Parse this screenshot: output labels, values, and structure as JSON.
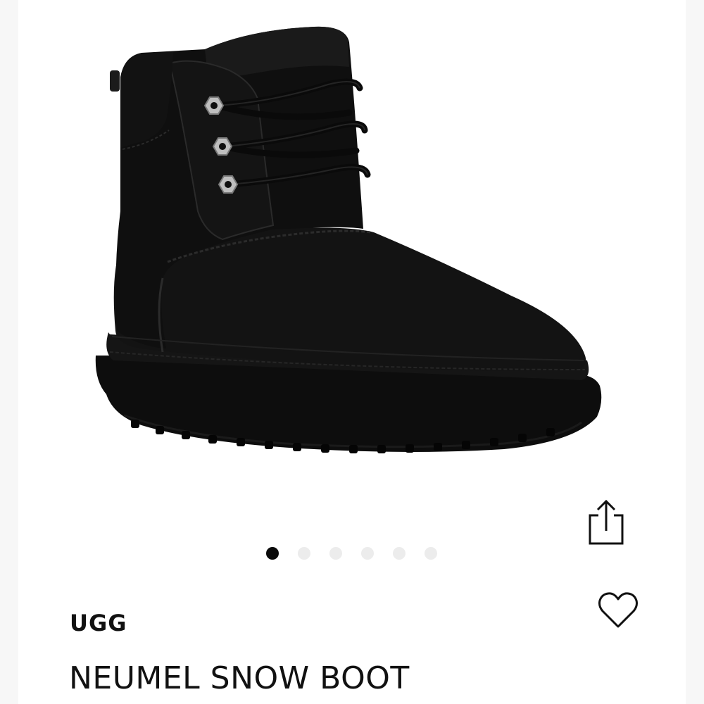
{
  "product": {
    "brand": "UGG",
    "name": "NEUMEL SNOW BOOT",
    "image_alt": "Black suede lace-up boot"
  },
  "gallery": {
    "total_images": 6,
    "active_index": 0
  },
  "actions": {
    "share_icon": "share-icon",
    "favorite_icon": "heart-icon"
  },
  "colors": {
    "boot": "#111111",
    "dot_active": "#0a0a0a",
    "dot_inactive": "#ececec"
  }
}
